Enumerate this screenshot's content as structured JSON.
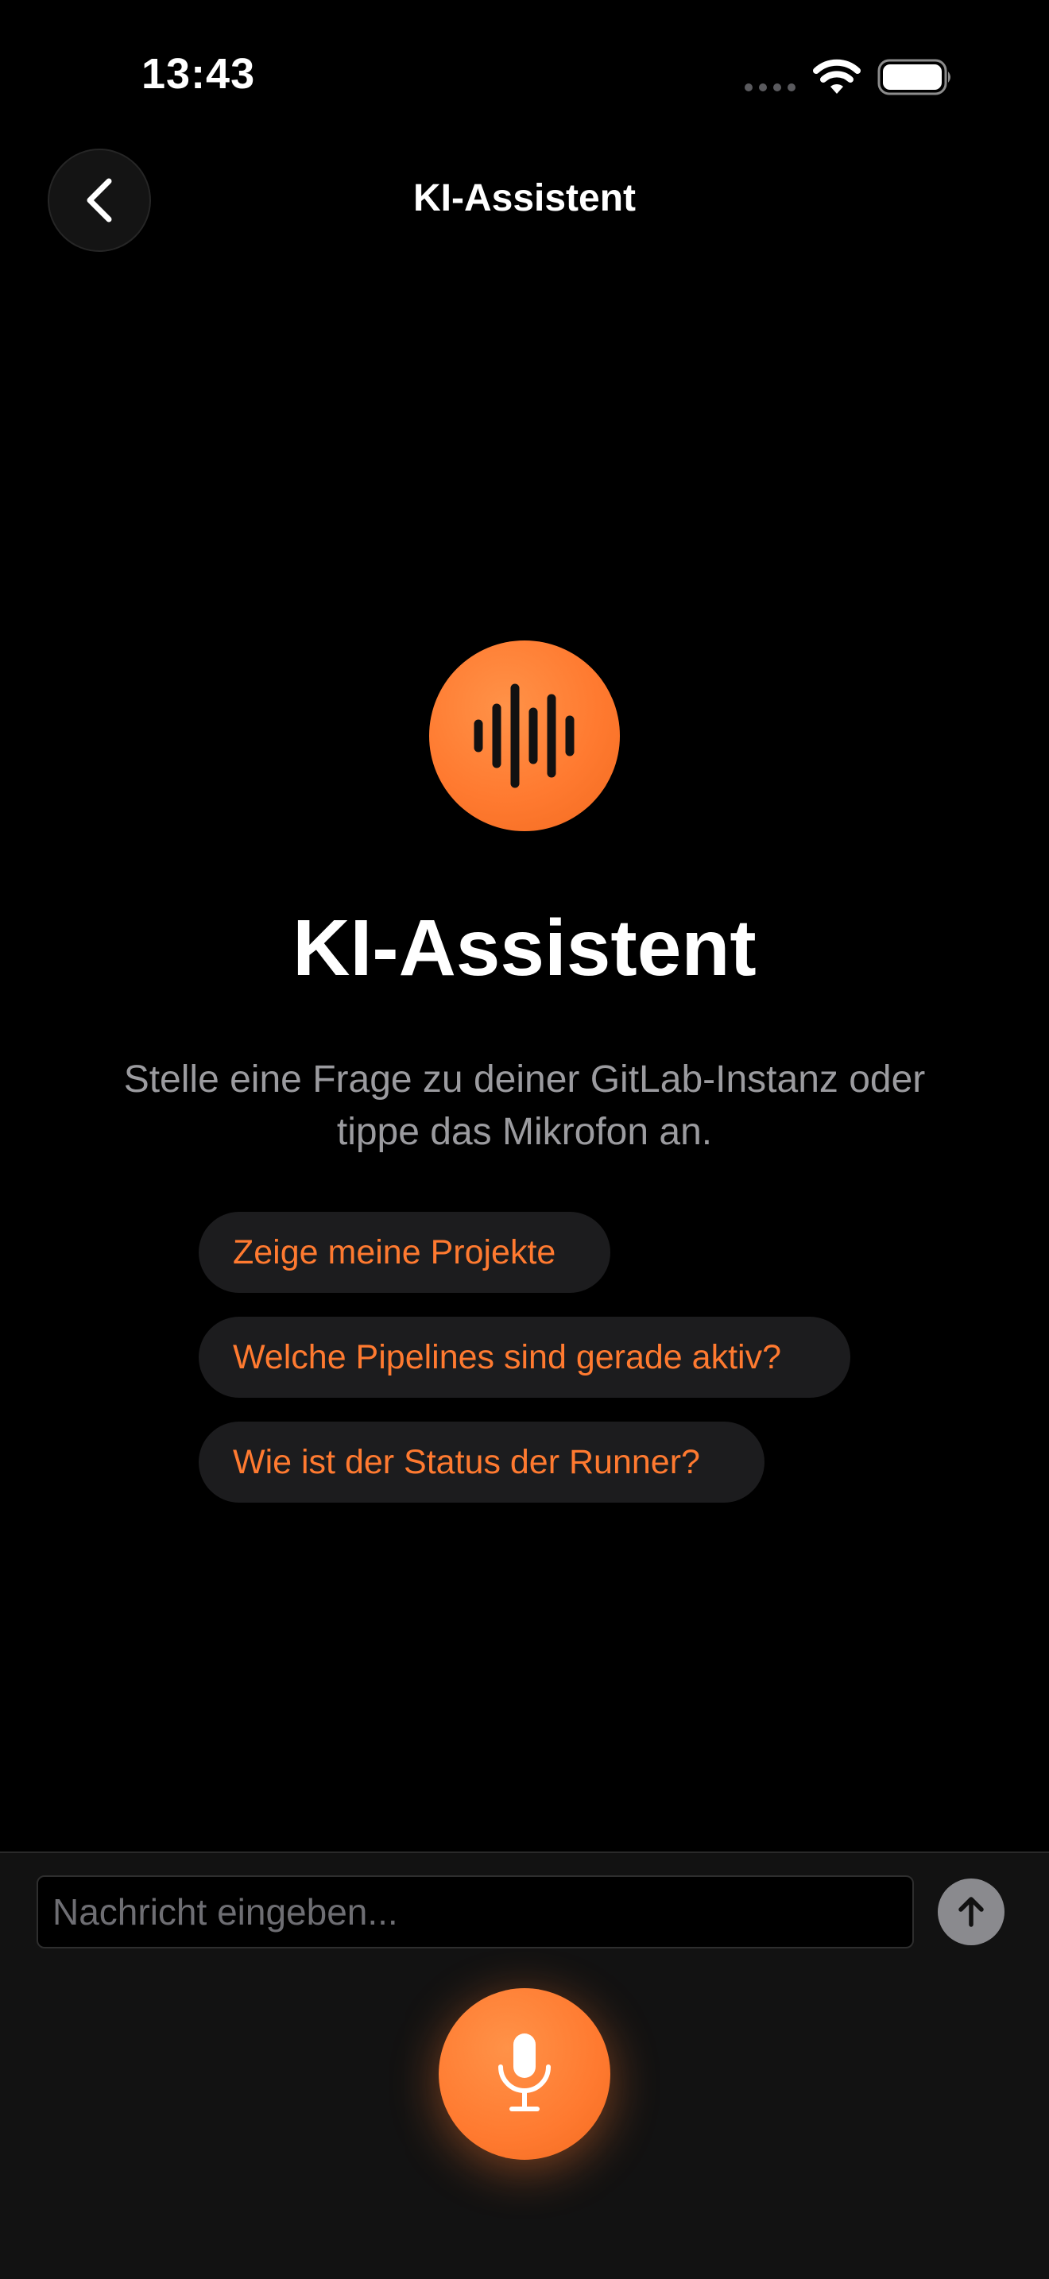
{
  "status_bar": {
    "time": "13:43"
  },
  "nav": {
    "title": "KI-Assistent",
    "back_icon": "chevron-left-icon"
  },
  "hero": {
    "icon": "waveform-icon",
    "title": "KI-Assistent",
    "subtitle": "Stelle eine Frage zu deiner GitLab-Instanz oder tippe das Mikrofon an."
  },
  "suggestions": [
    {
      "label": "Zeige meine Projekte"
    },
    {
      "label": "Welche Pipelines sind gerade aktiv?"
    },
    {
      "label": "Wie ist der Status der Runner?"
    }
  ],
  "composer": {
    "placeholder": "Nachricht eingeben...",
    "value": "",
    "send_icon": "arrow-up-icon",
    "mic_icon": "microphone-icon"
  },
  "colors": {
    "background": "#000000",
    "accent": "#ff7a30",
    "chip_background": "#1c1c1e",
    "secondary_text": "#9b9b9f"
  }
}
